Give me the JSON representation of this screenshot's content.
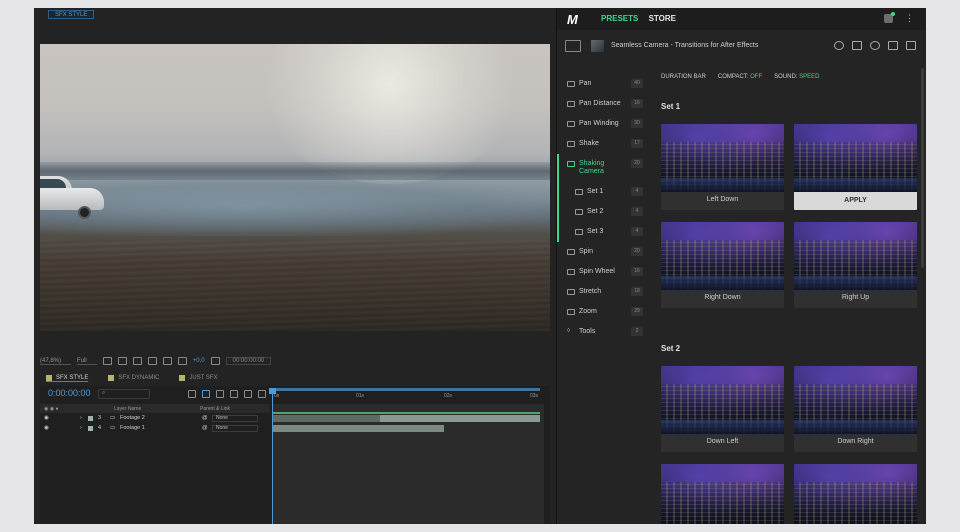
{
  "ae": {
    "comp_tab": "SFX STYLE",
    "viewer_bar": {
      "zoom": "(47,8%)",
      "resolution": "Full",
      "exposure": "+0,0",
      "timecode": "00:00:00:00"
    },
    "timeline_tabs": [
      "SFX STYLE",
      "SFX DYNAMIC",
      "JUST SFX"
    ],
    "timecode": "0:00:00:00",
    "ruler_labels": [
      "0s",
      "01s",
      "02s",
      "03s"
    ],
    "columns": {
      "layer_name": "Layer Name",
      "parent": "Parent & Link"
    },
    "layers": [
      {
        "num": "3",
        "name": "Footage 2",
        "parent": "None"
      },
      {
        "num": "4",
        "name": "Footage 1",
        "parent": "None"
      }
    ]
  },
  "panel": {
    "logo": "M",
    "nav_presets": "PRESETS",
    "nav_store": "STORE",
    "pack_title": "Seamless Camera - Transitions for After Effects",
    "sidebar": [
      {
        "label": "Pan",
        "count": "40"
      },
      {
        "label": "Pan Distance",
        "count": "16"
      },
      {
        "label": "Pan Winding",
        "count": "30"
      },
      {
        "label": "Shake",
        "count": "17"
      },
      {
        "label": "Shaking Camera",
        "count": "20"
      },
      {
        "label": "Set 1",
        "count": "4"
      },
      {
        "label": "Set 2",
        "count": "4"
      },
      {
        "label": "Set 3",
        "count": "4"
      },
      {
        "label": "Spin",
        "count": "20"
      },
      {
        "label": "Spin Wheel",
        "count": "16"
      },
      {
        "label": "Stretch",
        "count": "18"
      },
      {
        "label": "Zoom",
        "count": "29"
      },
      {
        "label": "Tools",
        "count": "2"
      }
    ],
    "options": {
      "duration": "DURATION BAR",
      "compact_label": "COMPACT:",
      "compact_value": "OFF",
      "sound_label": "SOUND:",
      "sound_value": "SPEED"
    },
    "set1_title": "Set 1",
    "set2_title": "Set 2",
    "cards": [
      {
        "label": "Left Down"
      },
      {
        "label": "APPLY"
      },
      {
        "label": "Right Down"
      },
      {
        "label": "Right Up"
      },
      {
        "label": "Down Left"
      },
      {
        "label": "Down Right"
      }
    ],
    "accent_color": "#3fd68a"
  }
}
